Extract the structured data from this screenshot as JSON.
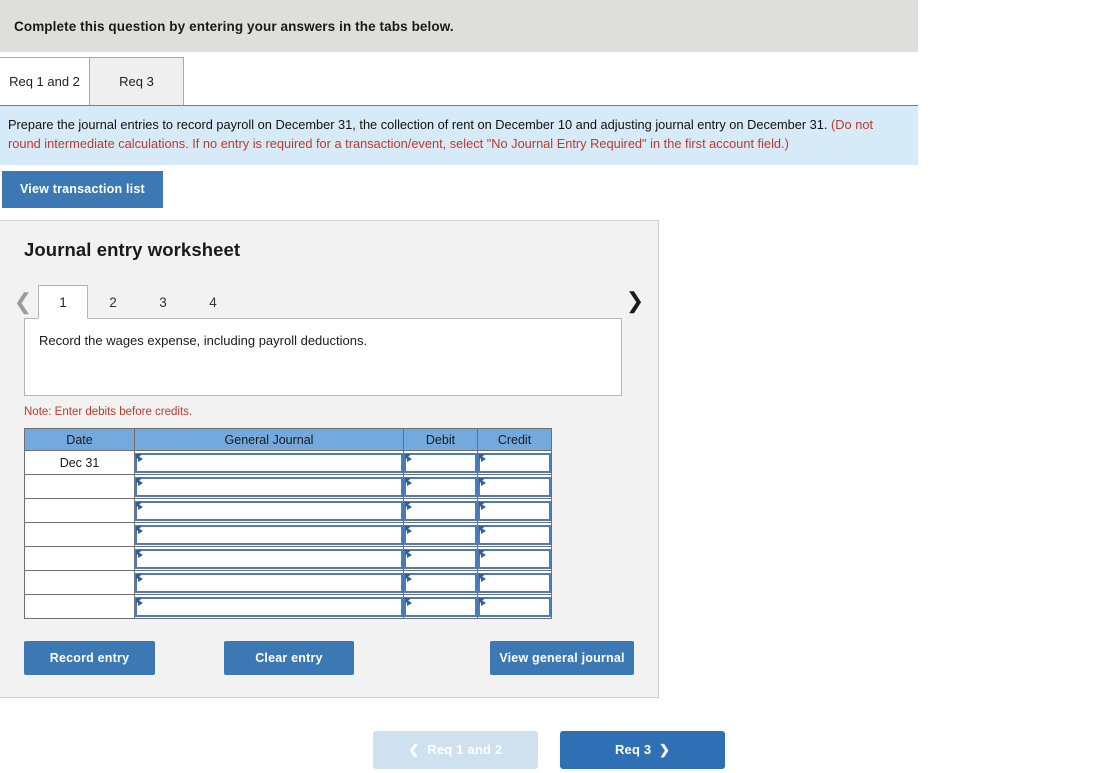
{
  "banner": {
    "text": "Complete this question by entering your answers in the tabs below."
  },
  "tabs": [
    {
      "label": "Req 1 and 2",
      "active": true
    },
    {
      "label": "Req 3",
      "active": false
    }
  ],
  "instructions": {
    "part1": "Prepare the journal entries to record payroll on December 31, the collection of rent on December 10 and adjusting journal entry on December 31. ",
    "part2_red": "(Do not round intermediate calculations. If no entry is required for a transaction/event, select \"No Journal Entry Required\" in the first account field.)"
  },
  "view_transaction_list": {
    "label": "View transaction list"
  },
  "worksheet": {
    "title": "Journal entry worksheet",
    "pager": {
      "prev_icon": "chevron-left-icon",
      "next_icon": "chevron-right-icon",
      "pages": [
        {
          "label": "1",
          "active": true
        },
        {
          "label": "2",
          "active": false
        },
        {
          "label": "3",
          "active": false
        },
        {
          "label": "4",
          "active": false
        }
      ]
    },
    "description": "Record the wages expense, including payroll deductions.",
    "note": "Note: Enter debits before credits.",
    "table": {
      "headers": [
        "Date",
        "General Journal",
        "Debit",
        "Credit"
      ],
      "rows": [
        {
          "date": "Dec 31",
          "general_journal": "",
          "debit": "",
          "credit": ""
        },
        {
          "date": "",
          "general_journal": "",
          "debit": "",
          "credit": ""
        },
        {
          "date": "",
          "general_journal": "",
          "debit": "",
          "credit": ""
        },
        {
          "date": "",
          "general_journal": "",
          "debit": "",
          "credit": ""
        },
        {
          "date": "",
          "general_journal": "",
          "debit": "",
          "credit": ""
        },
        {
          "date": "",
          "general_journal": "",
          "debit": "",
          "credit": ""
        },
        {
          "date": "",
          "general_journal": "",
          "debit": "",
          "credit": ""
        }
      ]
    },
    "actions": {
      "record": "Record entry",
      "clear": "Clear entry",
      "view_general_journal": "View general journal"
    }
  },
  "req_nav": {
    "prev": {
      "label": "Req 1 and 2",
      "icon": "chevron-left-icon",
      "disabled": true
    },
    "next": {
      "label": "Req 3",
      "icon": "chevron-right-icon",
      "disabled": false
    }
  },
  "colors": {
    "accent": "#3c78b4",
    "table_header": "#74a9dd",
    "instruction_bg": "#d7eaf8",
    "banner_bg": "#dededd",
    "red_text": "#c0392b"
  }
}
